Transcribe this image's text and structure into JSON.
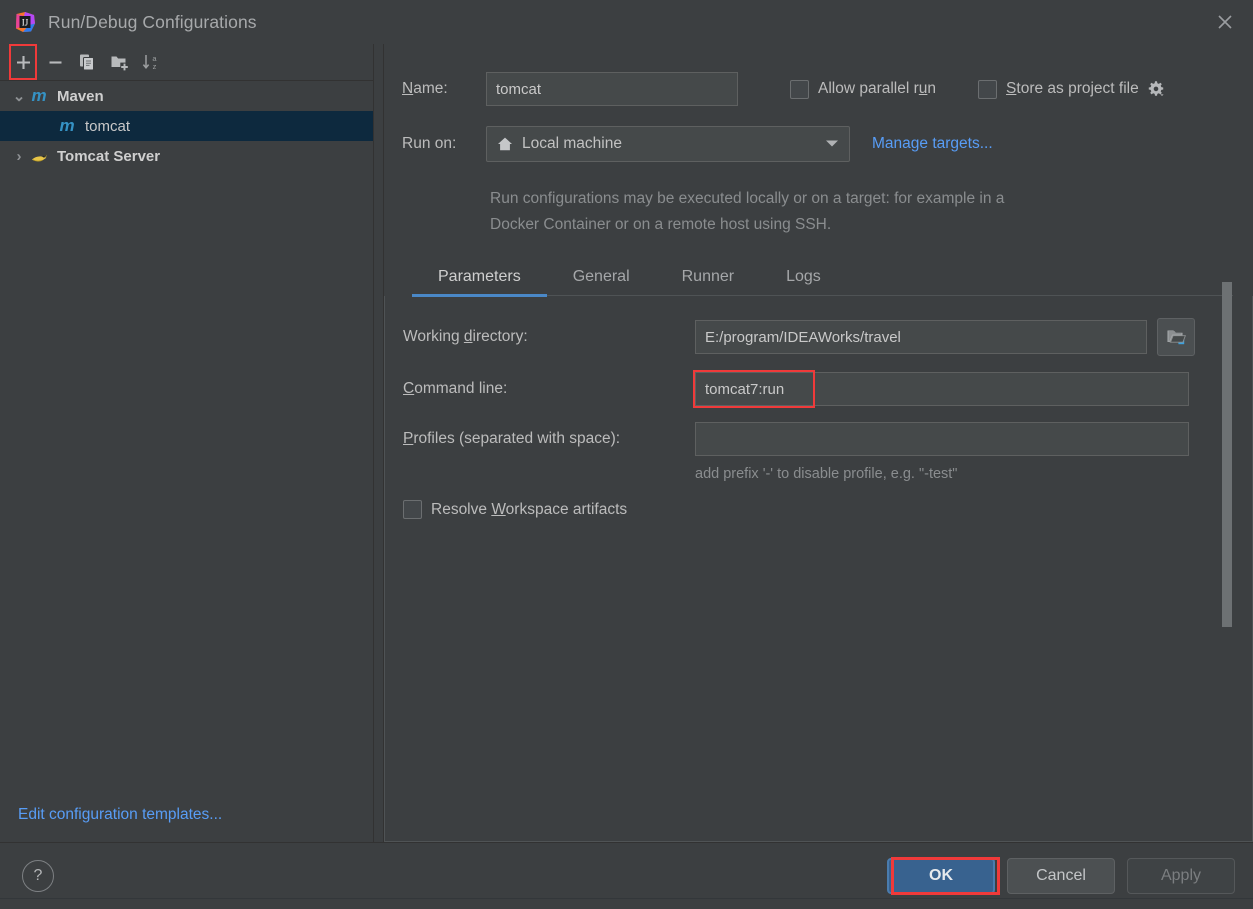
{
  "window": {
    "title": "Run/Debug Configurations",
    "logo_icon": "intellij-idea-logo",
    "close_icon": "close-icon"
  },
  "tree_toolbar": {
    "buttons": [
      {
        "name": "add-configuration-button",
        "icon": "plus-icon",
        "label": "+",
        "highlighted": true
      },
      {
        "name": "remove-configuration-button",
        "icon": "minus-icon",
        "label": "−",
        "highlighted": false
      },
      {
        "name": "copy-configuration-button",
        "icon": "copy-icon",
        "label": "",
        "highlighted": false
      },
      {
        "name": "new-folder-button",
        "icon": "folder-add-icon",
        "label": "",
        "highlighted": false
      },
      {
        "name": "sort-configurations-button",
        "icon": "sort-az-icon",
        "label": "",
        "highlighted": false
      }
    ]
  },
  "tree": {
    "items": [
      {
        "label": "Maven",
        "icon": "maven-icon",
        "twisty": "⌄",
        "expanded": true,
        "level": 0,
        "selected": false
      },
      {
        "label": "tomcat",
        "icon": "maven-icon",
        "twisty": "",
        "expanded": false,
        "level": 1,
        "selected": true
      },
      {
        "label": "Tomcat Server",
        "icon": "tomcat-icon",
        "twisty": "›",
        "expanded": false,
        "level": 0,
        "selected": false
      }
    ],
    "edit_templates_link": "Edit configuration templates..."
  },
  "editor": {
    "name_label": "Name:",
    "name_label_mnemonic": "N",
    "name_value": "tomcat",
    "name_placeholder": "",
    "allow_parallel_run": {
      "label": "Allow parallel run",
      "checked": false
    },
    "store_as_project_file": {
      "label": "Store as project file",
      "checked": false,
      "gear_icon": "gear-dropdown-icon"
    },
    "run_on_label": "Run on:",
    "run_on_value": "Local machine",
    "run_on_icon": "home-icon",
    "manage_targets_link": "Manage targets...",
    "target_hint": "Run configurations may be executed locally or on a target: for example in a Docker Container or on a remote host using SSH.",
    "tabs": [
      {
        "label": "Parameters",
        "active": true
      },
      {
        "label": "General",
        "active": false
      },
      {
        "label": "Runner",
        "active": false
      },
      {
        "label": "Logs",
        "active": false
      }
    ],
    "parameters": {
      "working_directory_label": "Working directory:",
      "working_directory_mnemonic": "d",
      "working_directory_value": "E:/program/IDEAWorks/travel",
      "working_directory_browse_icon": "folder-open-icon",
      "module_dir_button_icon": "module-folder-icon",
      "command_line_label": "Command line:",
      "command_line_mnemonic": "C",
      "command_line_value": "tomcat7:run",
      "command_line_highlighted": true,
      "profiles_label": "Profiles (separated with space):",
      "profiles_mnemonic": "P",
      "profiles_value": "",
      "profiles_hint": "add prefix '-' to disable profile, e.g. \"-test\"",
      "resolve_workspace_artifacts": {
        "label": "Resolve Workspace artifacts",
        "mnemonic": "W",
        "checked": false
      }
    }
  },
  "footer": {
    "help_label": "?",
    "ok_label": "OK",
    "cancel_label": "Cancel",
    "apply_label": "Apply",
    "ok_highlighted": true,
    "apply_enabled": false
  },
  "colors": {
    "background": "#3c3f41",
    "panel_border": "#4f5355",
    "accent_blue": "#4a88c7",
    "link_blue": "#589df6",
    "selection": "#0d293e",
    "highlight_red": "#f03a3a",
    "maven_icon_blue": "#3592c4",
    "tomcat_icon_yellow": "#e8c547",
    "default_button": "#38628f"
  }
}
